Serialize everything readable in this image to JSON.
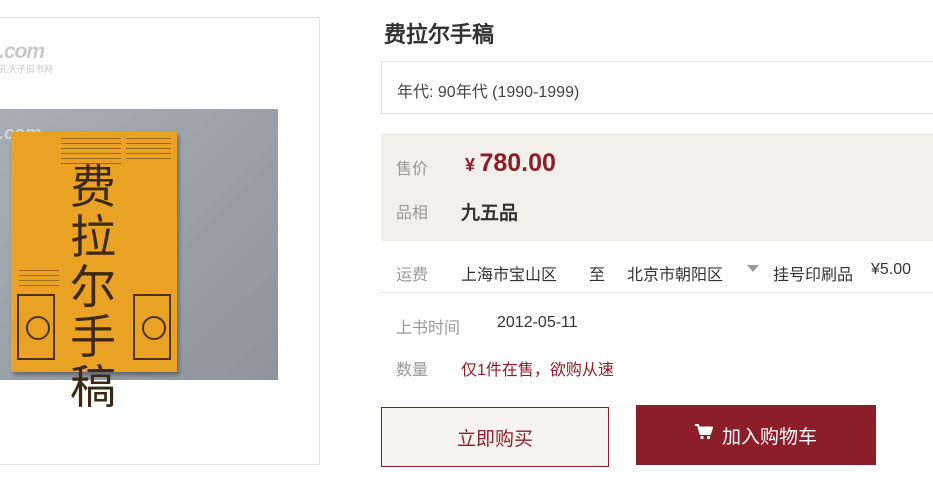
{
  "product": {
    "title": "费拉尔手稿",
    "era": "年代: 90年代 (1990-1999)",
    "cover_title": "费拉尔手稿",
    "watermark": ".com",
    "watermark_sub": "孔夫子旧书网"
  },
  "price_panel": {
    "price_label": "售价",
    "currency": "¥",
    "price": "780.00",
    "grade_label": "品相",
    "grade": "九五品"
  },
  "shipping": {
    "label": "运费",
    "from": "上海市宝山区",
    "to_word": "至",
    "to": "北京市朝阳区",
    "method": "挂号印刷品",
    "fee": "¥5.00"
  },
  "listing": {
    "date_label": "上书时间",
    "date": "2012-05-11",
    "qty_label": "数量",
    "qty_text": "仅1件在售，欲购从速"
  },
  "actions": {
    "buy_now": "立即购买",
    "add_to_cart": "加入购物车"
  },
  "colors": {
    "accent": "#8c1e2a",
    "price_panel_bg": "#f3efe9"
  }
}
